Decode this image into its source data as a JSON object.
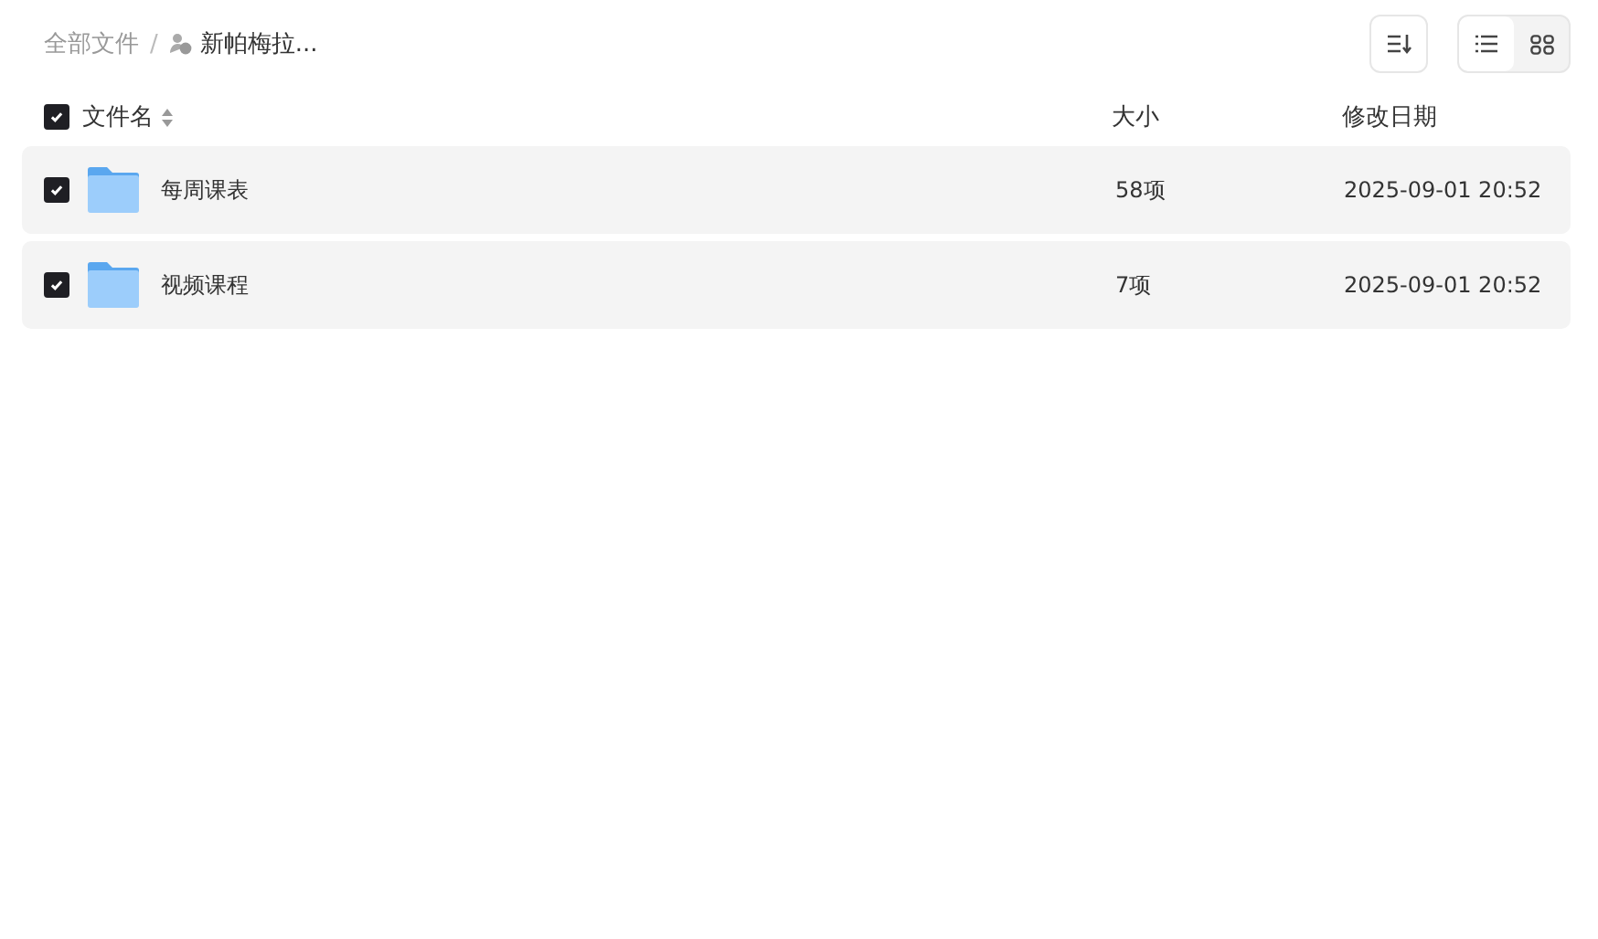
{
  "breadcrumb": [
    {
      "label": "全部文件",
      "kind": "link"
    },
    {
      "label": "/",
      "kind": "separator"
    },
    {
      "label": "新帕梅拉...",
      "kind": "current"
    }
  ],
  "view_modes": [
    {
      "kind": "list",
      "selected": true
    },
    {
      "kind": "grid",
      "selected": false
    }
  ],
  "table": {
    "select_all_checked": true,
    "columns": [
      "文件名",
      "大小",
      "修改日期"
    ],
    "rows": [
      {
        "name": "每周课表",
        "size": "58项",
        "modified": "2025-09-01 20:52",
        "checked": true
      },
      {
        "name": "视频课程",
        "size": "7项",
        "modified": "2025-09-01 20:52",
        "checked": true
      }
    ]
  }
}
